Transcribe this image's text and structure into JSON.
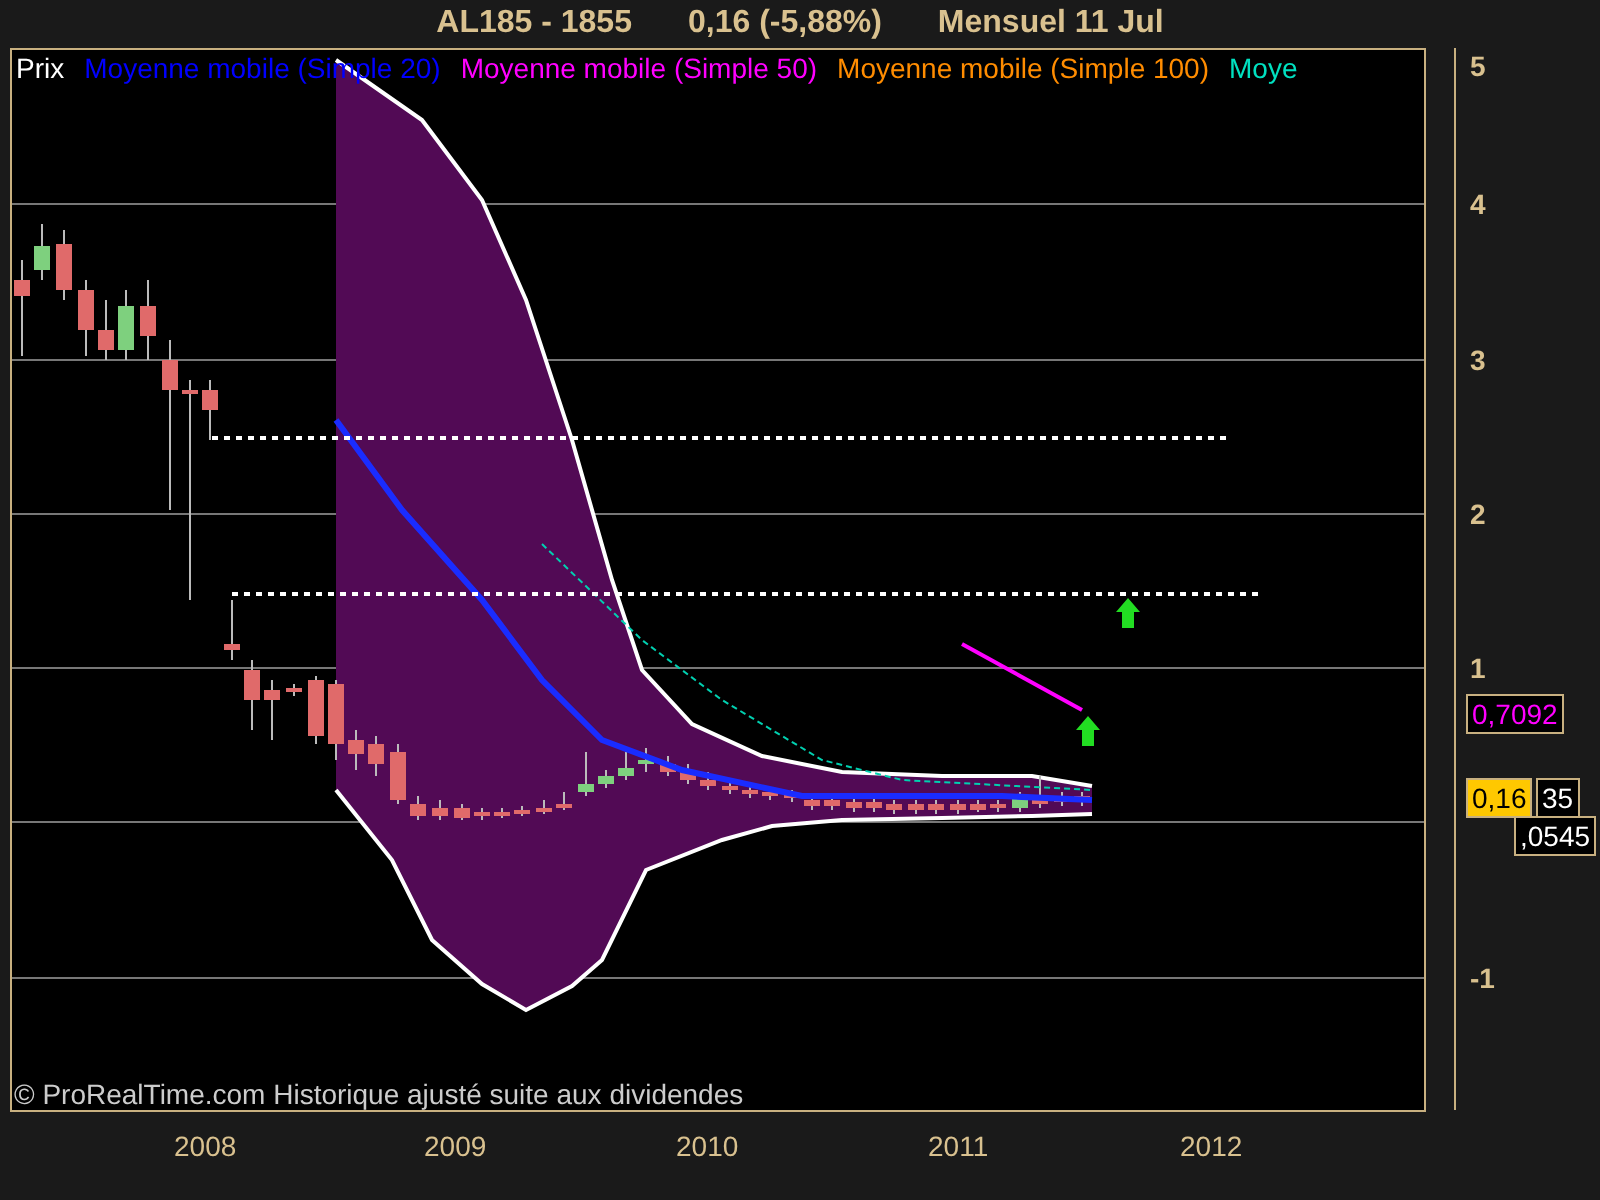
{
  "title": {
    "symbol": "AL185 - 1855",
    "quote": "0,16 (-5,88%)",
    "period": "Mensuel  11 Jul"
  },
  "legend": [
    {
      "label": "Prix",
      "color": "#ffffff"
    },
    {
      "label": "Moyenne mobile (Simple 20)",
      "color": "#0000ff"
    },
    {
      "label": "Moyenne mobile (Simple 50)",
      "color": "#ff00ff"
    },
    {
      "label": "Moyenne mobile (Simple 100)",
      "color": "#ff8c00"
    },
    {
      "label": "Moye",
      "color": "#00e0c0"
    }
  ],
  "y_axis": {
    "ticks": [
      "5",
      "4",
      "3",
      "2",
      "1",
      "-1"
    ]
  },
  "x_axis": {
    "ticks": [
      "2008",
      "2009",
      "2010",
      "2011",
      "2012"
    ]
  },
  "price_labels": [
    {
      "text": "0,7092",
      "kind": "boxed",
      "color": "#ff00ff"
    },
    {
      "text": "0,16",
      "kind": "current"
    },
    {
      "text": "35",
      "kind": "boxed",
      "color": "#ffffff"
    },
    {
      "text": ",0545",
      "kind": "boxed",
      "color": "#ffffff"
    }
  ],
  "footer": "© ProRealTime.com Historique ajusté suite aux dividendes"
}
